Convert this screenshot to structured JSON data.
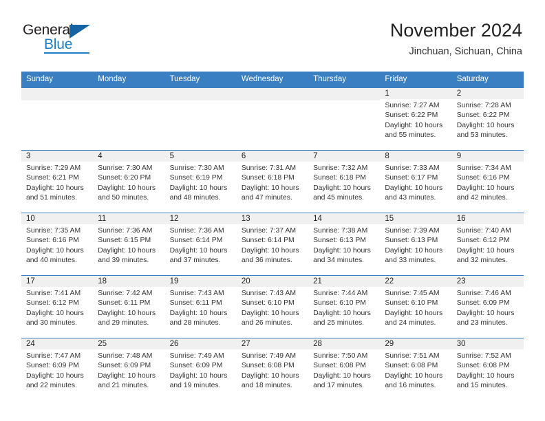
{
  "brand": {
    "name_part1": "General",
    "name_part2": "Blue",
    "accent_color": "#1f7fc4",
    "triangle_color": "#1464a5"
  },
  "header": {
    "title": "November 2024",
    "subtitle": "Jinchuan, Sichuan, China"
  },
  "calendar": {
    "header_bg": "#3a7fc1",
    "daynum_bg": "#f0f0f0",
    "weekday_headers": [
      "Sunday",
      "Monday",
      "Tuesday",
      "Wednesday",
      "Thursday",
      "Friday",
      "Saturday"
    ],
    "labels": {
      "sunrise": "Sunrise:",
      "sunset": "Sunset:",
      "daylight": "Daylight:"
    },
    "weeks": [
      [
        {
          "blank": true
        },
        {
          "blank": true
        },
        {
          "blank": true
        },
        {
          "blank": true
        },
        {
          "blank": true
        },
        {
          "day": "1",
          "sunrise": "Sunrise: 7:27 AM",
          "sunset": "Sunset: 6:22 PM",
          "daylight_line1": "Daylight: 10 hours",
          "daylight_line2": "and 55 minutes."
        },
        {
          "day": "2",
          "sunrise": "Sunrise: 7:28 AM",
          "sunset": "Sunset: 6:22 PM",
          "daylight_line1": "Daylight: 10 hours",
          "daylight_line2": "and 53 minutes."
        }
      ],
      [
        {
          "day": "3",
          "sunrise": "Sunrise: 7:29 AM",
          "sunset": "Sunset: 6:21 PM",
          "daylight_line1": "Daylight: 10 hours",
          "daylight_line2": "and 51 minutes."
        },
        {
          "day": "4",
          "sunrise": "Sunrise: 7:30 AM",
          "sunset": "Sunset: 6:20 PM",
          "daylight_line1": "Daylight: 10 hours",
          "daylight_line2": "and 50 minutes."
        },
        {
          "day": "5",
          "sunrise": "Sunrise: 7:30 AM",
          "sunset": "Sunset: 6:19 PM",
          "daylight_line1": "Daylight: 10 hours",
          "daylight_line2": "and 48 minutes."
        },
        {
          "day": "6",
          "sunrise": "Sunrise: 7:31 AM",
          "sunset": "Sunset: 6:18 PM",
          "daylight_line1": "Daylight: 10 hours",
          "daylight_line2": "and 47 minutes."
        },
        {
          "day": "7",
          "sunrise": "Sunrise: 7:32 AM",
          "sunset": "Sunset: 6:18 PM",
          "daylight_line1": "Daylight: 10 hours",
          "daylight_line2": "and 45 minutes."
        },
        {
          "day": "8",
          "sunrise": "Sunrise: 7:33 AM",
          "sunset": "Sunset: 6:17 PM",
          "daylight_line1": "Daylight: 10 hours",
          "daylight_line2": "and 43 minutes."
        },
        {
          "day": "9",
          "sunrise": "Sunrise: 7:34 AM",
          "sunset": "Sunset: 6:16 PM",
          "daylight_line1": "Daylight: 10 hours",
          "daylight_line2": "and 42 minutes."
        }
      ],
      [
        {
          "day": "10",
          "sunrise": "Sunrise: 7:35 AM",
          "sunset": "Sunset: 6:16 PM",
          "daylight_line1": "Daylight: 10 hours",
          "daylight_line2": "and 40 minutes."
        },
        {
          "day": "11",
          "sunrise": "Sunrise: 7:36 AM",
          "sunset": "Sunset: 6:15 PM",
          "daylight_line1": "Daylight: 10 hours",
          "daylight_line2": "and 39 minutes."
        },
        {
          "day": "12",
          "sunrise": "Sunrise: 7:36 AM",
          "sunset": "Sunset: 6:14 PM",
          "daylight_line1": "Daylight: 10 hours",
          "daylight_line2": "and 37 minutes."
        },
        {
          "day": "13",
          "sunrise": "Sunrise: 7:37 AM",
          "sunset": "Sunset: 6:14 PM",
          "daylight_line1": "Daylight: 10 hours",
          "daylight_line2": "and 36 minutes."
        },
        {
          "day": "14",
          "sunrise": "Sunrise: 7:38 AM",
          "sunset": "Sunset: 6:13 PM",
          "daylight_line1": "Daylight: 10 hours",
          "daylight_line2": "and 34 minutes."
        },
        {
          "day": "15",
          "sunrise": "Sunrise: 7:39 AM",
          "sunset": "Sunset: 6:13 PM",
          "daylight_line1": "Daylight: 10 hours",
          "daylight_line2": "and 33 minutes."
        },
        {
          "day": "16",
          "sunrise": "Sunrise: 7:40 AM",
          "sunset": "Sunset: 6:12 PM",
          "daylight_line1": "Daylight: 10 hours",
          "daylight_line2": "and 32 minutes."
        }
      ],
      [
        {
          "day": "17",
          "sunrise": "Sunrise: 7:41 AM",
          "sunset": "Sunset: 6:12 PM",
          "daylight_line1": "Daylight: 10 hours",
          "daylight_line2": "and 30 minutes."
        },
        {
          "day": "18",
          "sunrise": "Sunrise: 7:42 AM",
          "sunset": "Sunset: 6:11 PM",
          "daylight_line1": "Daylight: 10 hours",
          "daylight_line2": "and 29 minutes."
        },
        {
          "day": "19",
          "sunrise": "Sunrise: 7:43 AM",
          "sunset": "Sunset: 6:11 PM",
          "daylight_line1": "Daylight: 10 hours",
          "daylight_line2": "and 28 minutes."
        },
        {
          "day": "20",
          "sunrise": "Sunrise: 7:43 AM",
          "sunset": "Sunset: 6:10 PM",
          "daylight_line1": "Daylight: 10 hours",
          "daylight_line2": "and 26 minutes."
        },
        {
          "day": "21",
          "sunrise": "Sunrise: 7:44 AM",
          "sunset": "Sunset: 6:10 PM",
          "daylight_line1": "Daylight: 10 hours",
          "daylight_line2": "and 25 minutes."
        },
        {
          "day": "22",
          "sunrise": "Sunrise: 7:45 AM",
          "sunset": "Sunset: 6:10 PM",
          "daylight_line1": "Daylight: 10 hours",
          "daylight_line2": "and 24 minutes."
        },
        {
          "day": "23",
          "sunrise": "Sunrise: 7:46 AM",
          "sunset": "Sunset: 6:09 PM",
          "daylight_line1": "Daylight: 10 hours",
          "daylight_line2": "and 23 minutes."
        }
      ],
      [
        {
          "day": "24",
          "sunrise": "Sunrise: 7:47 AM",
          "sunset": "Sunset: 6:09 PM",
          "daylight_line1": "Daylight: 10 hours",
          "daylight_line2": "and 22 minutes."
        },
        {
          "day": "25",
          "sunrise": "Sunrise: 7:48 AM",
          "sunset": "Sunset: 6:09 PM",
          "daylight_line1": "Daylight: 10 hours",
          "daylight_line2": "and 21 minutes."
        },
        {
          "day": "26",
          "sunrise": "Sunrise: 7:49 AM",
          "sunset": "Sunset: 6:09 PM",
          "daylight_line1": "Daylight: 10 hours",
          "daylight_line2": "and 19 minutes."
        },
        {
          "day": "27",
          "sunrise": "Sunrise: 7:49 AM",
          "sunset": "Sunset: 6:08 PM",
          "daylight_line1": "Daylight: 10 hours",
          "daylight_line2": "and 18 minutes."
        },
        {
          "day": "28",
          "sunrise": "Sunrise: 7:50 AM",
          "sunset": "Sunset: 6:08 PM",
          "daylight_line1": "Daylight: 10 hours",
          "daylight_line2": "and 17 minutes."
        },
        {
          "day": "29",
          "sunrise": "Sunrise: 7:51 AM",
          "sunset": "Sunset: 6:08 PM",
          "daylight_line1": "Daylight: 10 hours",
          "daylight_line2": "and 16 minutes."
        },
        {
          "day": "30",
          "sunrise": "Sunrise: 7:52 AM",
          "sunset": "Sunset: 6:08 PM",
          "daylight_line1": "Daylight: 10 hours",
          "daylight_line2": "and 15 minutes."
        }
      ]
    ]
  }
}
